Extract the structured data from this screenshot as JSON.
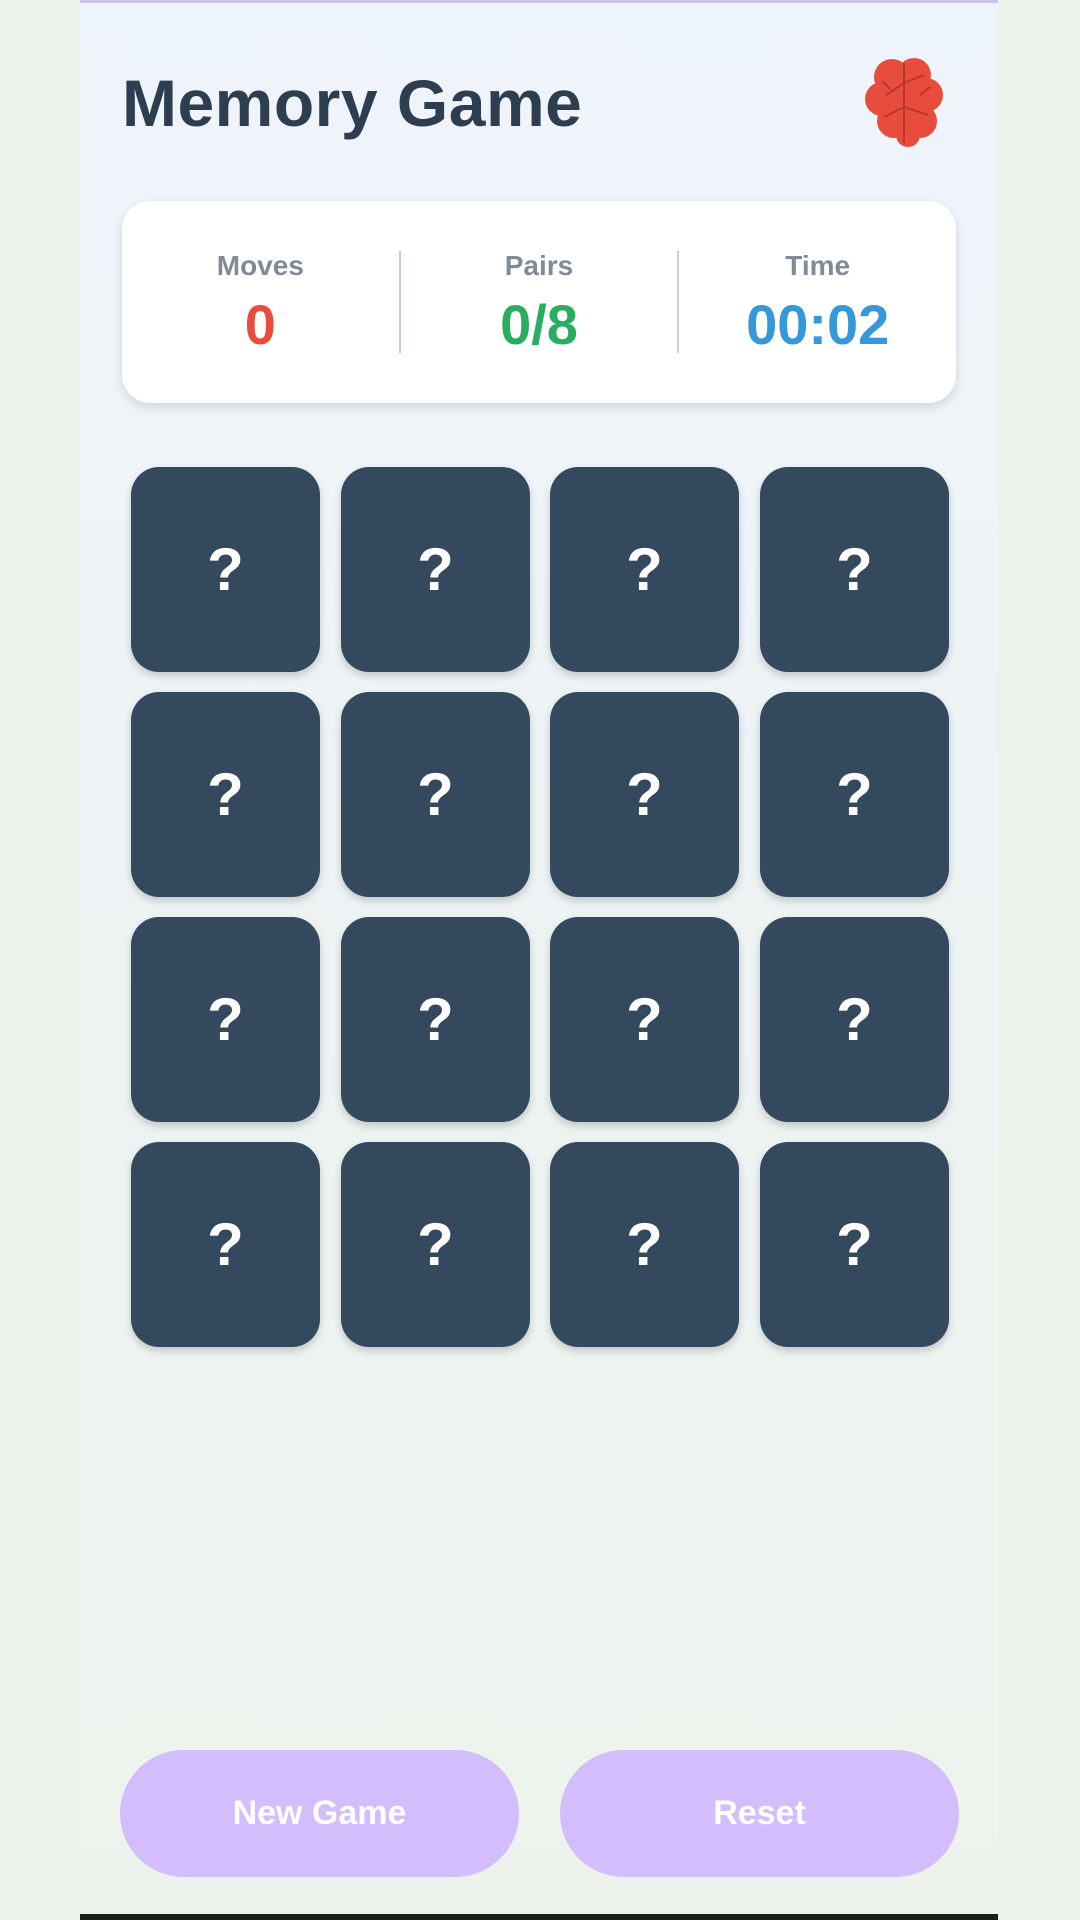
{
  "app": {
    "title": "Memory Game"
  },
  "stats": [
    {
      "label": "Moves",
      "value": "0",
      "color": "#e74c3c"
    },
    {
      "label": "Pairs",
      "value": "0/8",
      "color": "#27ae60"
    },
    {
      "label": "Time",
      "value": "00:02",
      "color": "#3498db"
    }
  ],
  "board": {
    "rows": 4,
    "cols": 4,
    "cards": [
      "?",
      "?",
      "?",
      "?",
      "?",
      "?",
      "?",
      "?",
      "?",
      "?",
      "?",
      "?",
      "?",
      "?",
      "?",
      "?"
    ]
  },
  "buttons": {
    "new_game_label": "New Game",
    "reset_label": "Reset"
  },
  "icons": {
    "header_icon": "brain-icon"
  },
  "colors": {
    "card_back": "#34495e",
    "title": "#2c3e50",
    "button_bg": "#d4bdfc",
    "moves": "#e74c3c",
    "pairs": "#27ae60",
    "time": "#3498db"
  }
}
